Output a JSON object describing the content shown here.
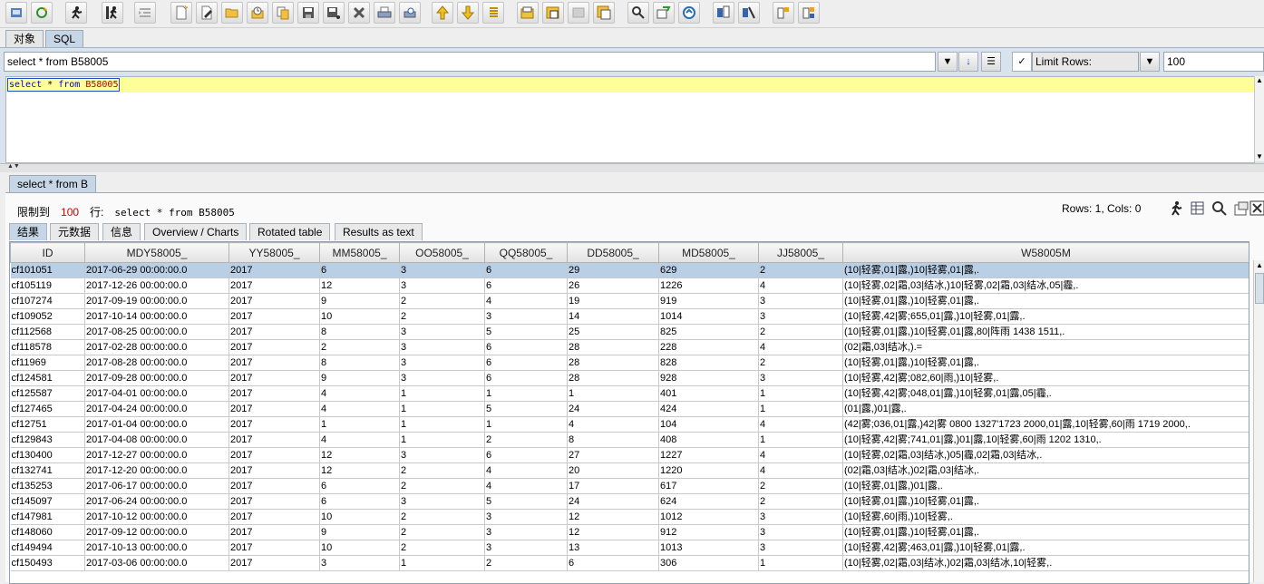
{
  "top_tabs": [
    "对象",
    "SQL"
  ],
  "toolbar": {
    "icons": [
      "open-connection-icon",
      "refresh-icon",
      "run-icon",
      "run-current-icon",
      "indent-icon",
      "new-icon",
      "edit-icon",
      "open-folder-icon",
      "history-icon",
      "copy-icon",
      "save-icon",
      "save-as-icon",
      "delete-icon",
      "print-icon",
      "print-preview-icon",
      "move-up-icon",
      "move-down-icon",
      "list-icon",
      "export-icon",
      "import-icon",
      "disabled-icon",
      "copy-table-icon",
      "find-icon",
      "find-replace-icon",
      "find-next-icon",
      "commit-icon",
      "rollback-icon",
      "transaction-icon",
      "auto-commit-icon"
    ]
  },
  "sql": {
    "combo_value": "select * from B58005",
    "limit_rows_checked": true,
    "limit_rows_label": "Limit Rows:",
    "limit_rows_value": "100",
    "editor": {
      "kw_select": "select",
      "star": "*",
      "kw_from": "from",
      "table": "B58005"
    }
  },
  "result": {
    "tab_label": "select * from B",
    "limit_label": "限制到",
    "limit_value": "100",
    "rows_label": "行:",
    "query_text": "select * from B58005",
    "rows_cols": "Rows: 1, Cols: 0",
    "sub_tabs": [
      "结果",
      "元数据",
      "信息",
      "Overview / Charts",
      "Rotated table",
      "Results as text"
    ],
    "columns": [
      "ID",
      "MDY58005_",
      "YY58005_",
      "MM58005_",
      "OO58005_",
      "QQ58005_",
      "DD58005_",
      "MD58005_",
      "JJ58005_",
      "W58005M"
    ],
    "rows": [
      [
        "cf101051",
        "2017-06-29 00:00:00.0",
        "2017",
        "6",
        "3",
        "6",
        "29",
        "629",
        "2",
        "(10|轻雾,01|露,)10|轻雾,01|露,."
      ],
      [
        "cf105119",
        "2017-12-26 00:00:00.0",
        "2017",
        "12",
        "3",
        "6",
        "26",
        "1226",
        "4",
        "(10|轻雾,02|霜,03|结冰,)10|轻雾,02|霜,03|结冰,05|霾,."
      ],
      [
        "cf107274",
        "2017-09-19 00:00:00.0",
        "2017",
        "9",
        "2",
        "4",
        "19",
        "919",
        "3",
        "(10|轻雾,01|露,)10|轻雾,01|露,."
      ],
      [
        "cf109052",
        "2017-10-14 00:00:00.0",
        "2017",
        "10",
        "2",
        "3",
        "14",
        "1014",
        "3",
        "(10|轻雾,42|雾;655,01|露,)10|轻雾,01|露,."
      ],
      [
        "cf112568",
        "2017-08-25 00:00:00.0",
        "2017",
        "8",
        "3",
        "5",
        "25",
        "825",
        "2",
        "(10|轻雾,01|露,)10|轻雾,01|露,80|阵雨 1438 1511,."
      ],
      [
        "cf118578",
        "2017-02-28 00:00:00.0",
        "2017",
        "2",
        "3",
        "6",
        "28",
        "228",
        "4",
        "(02|霜,03|结冰,).="
      ],
      [
        "cf11969",
        "2017-08-28 00:00:00.0",
        "2017",
        "8",
        "3",
        "6",
        "28",
        "828",
        "2",
        "(10|轻雾,01|露,)10|轻雾,01|露,."
      ],
      [
        "cf124581",
        "2017-09-28 00:00:00.0",
        "2017",
        "9",
        "3",
        "6",
        "28",
        "928",
        "3",
        "(10|轻雾,42|雾;082,60|雨,)10|轻雾,."
      ],
      [
        "cf125587",
        "2017-04-01 00:00:00.0",
        "2017",
        "4",
        "1",
        "1",
        "1",
        "401",
        "1",
        "(10|轻雾,42|雾;048,01|露,)10|轻雾,01|露,05|霾,."
      ],
      [
        "cf127465",
        "2017-04-24 00:00:00.0",
        "2017",
        "4",
        "1",
        "5",
        "24",
        "424",
        "1",
        "(01|露,)01|露,."
      ],
      [
        "cf12751",
        "2017-01-04 00:00:00.0",
        "2017",
        "1",
        "1",
        "1",
        "4",
        "104",
        "4",
        "(42|雾;036,01|露,)42|雾 0800   1327'1723   2000,01|露,10|轻雾,60|雨 1719 2000,."
      ],
      [
        "cf129843",
        "2017-04-08 00:00:00.0",
        "2017",
        "4",
        "1",
        "2",
        "8",
        "408",
        "1",
        "(10|轻雾,42|雾;741,01|露,)01|露,10|轻雾,60|雨 1202 1310,."
      ],
      [
        "cf130400",
        "2017-12-27 00:00:00.0",
        "2017",
        "12",
        "3",
        "6",
        "27",
        "1227",
        "4",
        "(10|轻雾,02|霜,03|结冰,)05|霾,02|霜,03|结冰,."
      ],
      [
        "cf132741",
        "2017-12-20 00:00:00.0",
        "2017",
        "12",
        "2",
        "4",
        "20",
        "1220",
        "4",
        "(02|霜,03|结冰,)02|霜,03|结冰,."
      ],
      [
        "cf135253",
        "2017-06-17 00:00:00.0",
        "2017",
        "6",
        "2",
        "4",
        "17",
        "617",
        "2",
        "(10|轻雾,01|露,)01|露,."
      ],
      [
        "cf145097",
        "2017-06-24 00:00:00.0",
        "2017",
        "6",
        "3",
        "5",
        "24",
        "624",
        "2",
        "(10|轻雾,01|露,)10|轻雾,01|露,."
      ],
      [
        "cf147981",
        "2017-10-12 00:00:00.0",
        "2017",
        "10",
        "2",
        "3",
        "12",
        "1012",
        "3",
        "(10|轻雾,60|雨,)10|轻雾,."
      ],
      [
        "cf148060",
        "2017-09-12 00:00:00.0",
        "2017",
        "9",
        "2",
        "3",
        "12",
        "912",
        "3",
        "(10|轻雾,01|露,)10|轻雾,01|露,."
      ],
      [
        "cf149494",
        "2017-10-13 00:00:00.0",
        "2017",
        "10",
        "2",
        "3",
        "13",
        "1013",
        "3",
        "(10|轻雾,42|雾;463,01|露,)10|轻雾,01|露,."
      ],
      [
        "cf150493",
        "2017-03-06 00:00:00.0",
        "2017",
        "3",
        "1",
        "2",
        "6",
        "306",
        "1",
        "(10|轻雾,02|霜,03|结冰,)02|霜,03|结冰,10|轻雾,."
      ]
    ]
  },
  "colors": {
    "accent": "#c7d6e6",
    "selected_row": "#b8cfe5",
    "editor_line": "#ffff99",
    "limit_number": "#cc0000"
  }
}
